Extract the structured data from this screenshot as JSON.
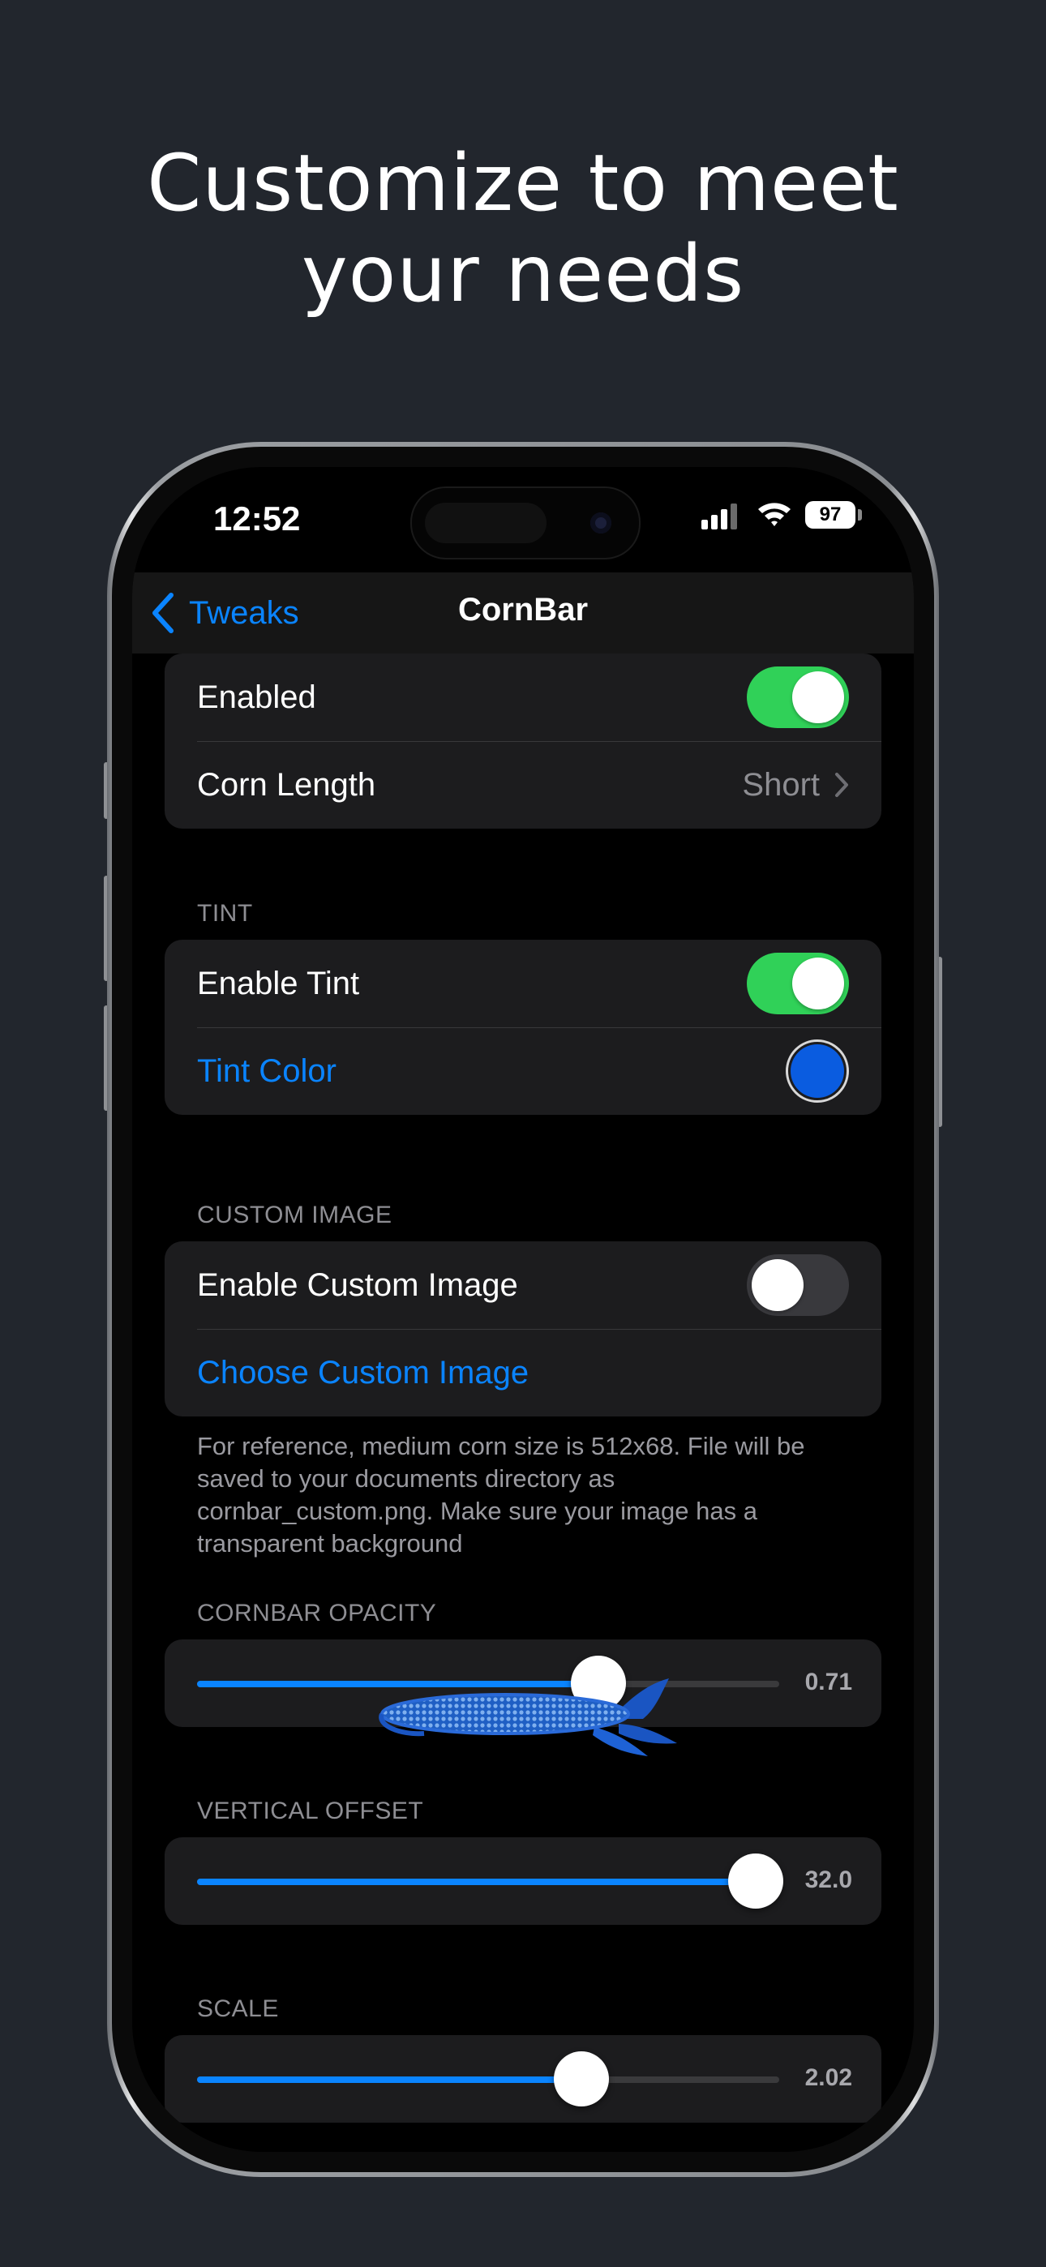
{
  "headline": {
    "line1": "Customize to meet",
    "line2": "your needs"
  },
  "status_bar": {
    "time": "12:52",
    "battery": "97"
  },
  "navbar": {
    "back_label": "Tweaks",
    "title": "CornBar"
  },
  "general": {
    "enabled_label": "Enabled",
    "enabled_on": true,
    "corn_length_label": "Corn Length",
    "corn_length_value": "Short"
  },
  "tint": {
    "header": "TINT",
    "enable_label": "Enable Tint",
    "enable_on": true,
    "color_label": "Tint Color",
    "color": "#0a5ce0"
  },
  "custom_image": {
    "header": "CUSTOM IMAGE",
    "enable_label": "Enable Custom Image",
    "enable_on": false,
    "choose_label": "Choose Custom Image",
    "footer": "For reference, medium corn size is 512x68. File will be saved to your documents directory as cornbar_custom.png. Make sure your image has a transparent background"
  },
  "sliders": [
    {
      "header": "CORNBAR OPACITY",
      "value_text": "0.71",
      "fraction": 0.69
    },
    {
      "header": "VERTICAL OFFSET",
      "value_text": "32.0",
      "fraction": 0.96
    },
    {
      "header": "SCALE",
      "value_text": "2.02",
      "fraction": 0.66
    }
  ],
  "colors": {
    "accent": "#0a84ff",
    "toggle_on": "#30d158",
    "background": "#22262d"
  },
  "icons": {
    "back": "chevron-left-icon",
    "disclosure": "chevron-right-icon",
    "signal": "cellular-signal-icon",
    "wifi": "wifi-icon",
    "battery": "battery-icon",
    "corn": "corn-icon"
  }
}
